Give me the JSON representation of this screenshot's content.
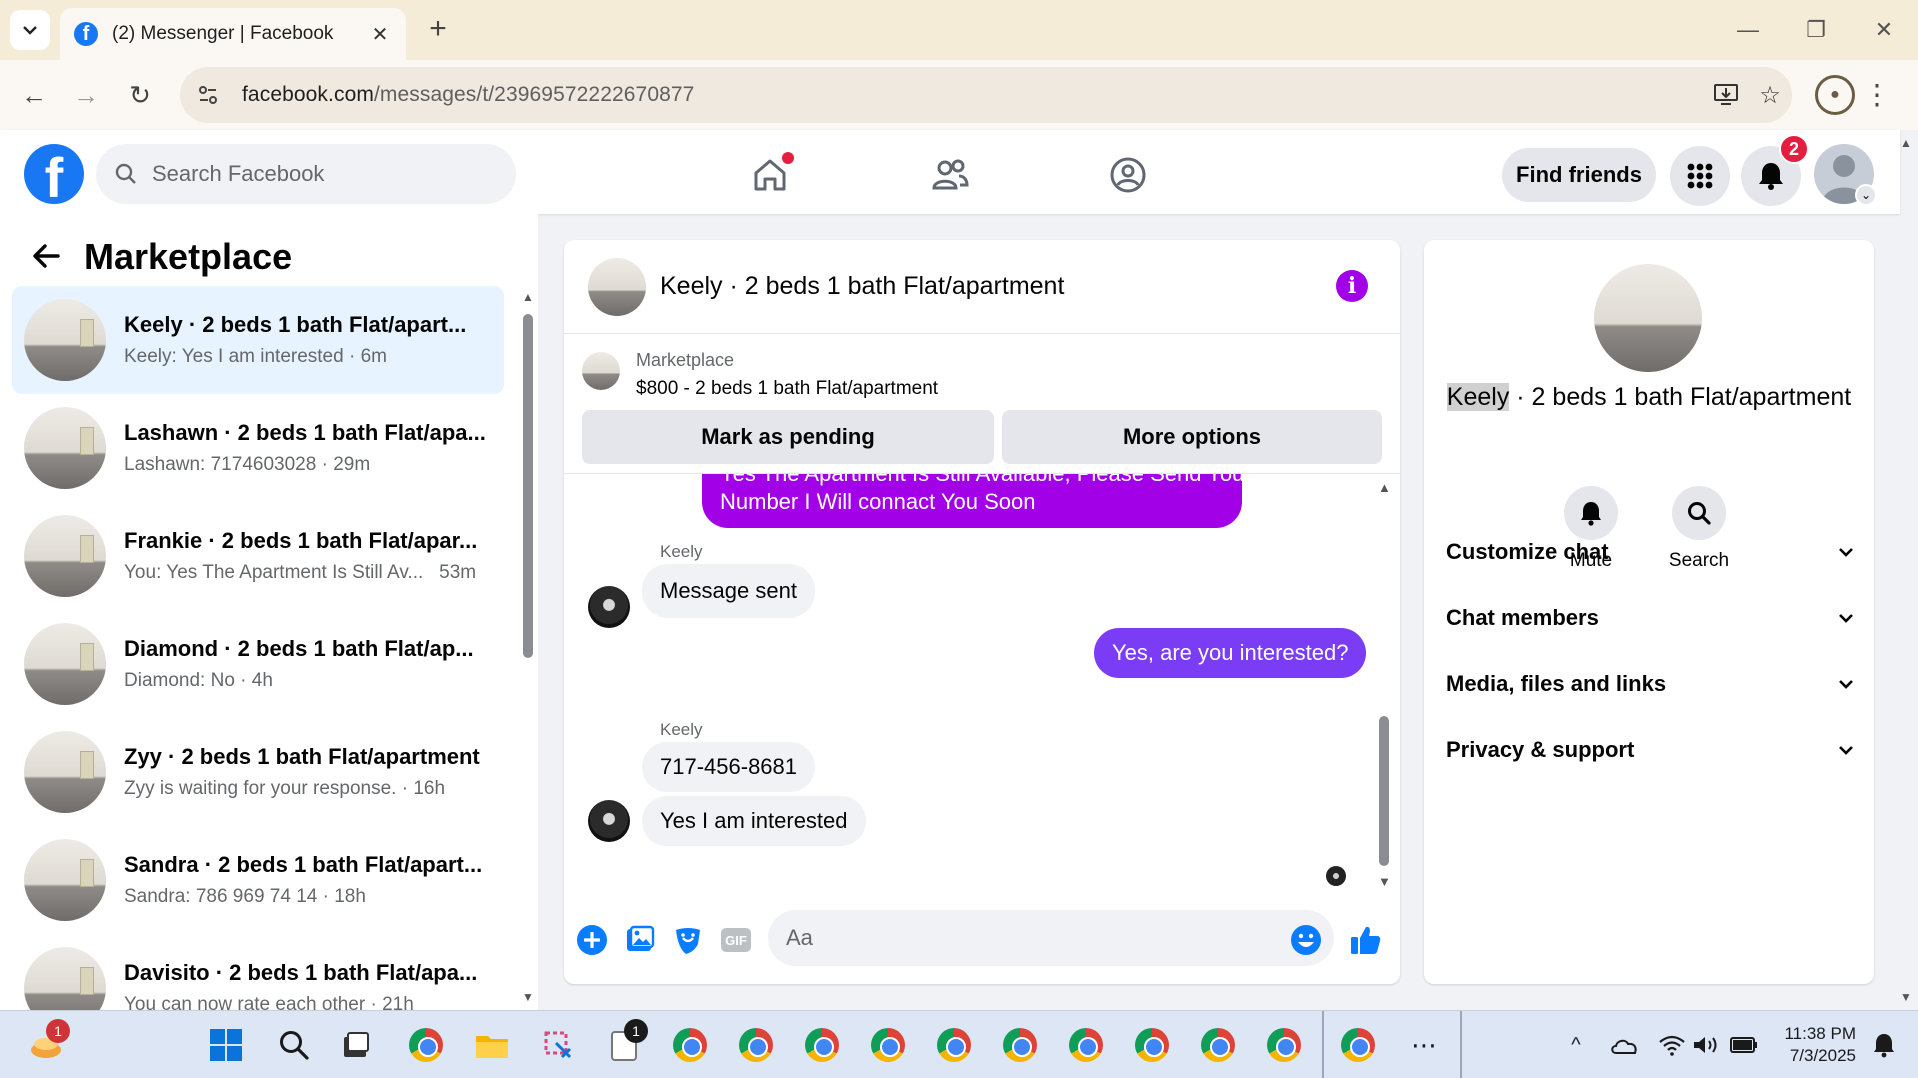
{
  "browser": {
    "tab_title": "(2) Messenger | Facebook",
    "url_host": "facebook.com",
    "url_path": "/messages/t/23969572222670877"
  },
  "header": {
    "search_placeholder": "Search Facebook",
    "find_friends": "Find friends",
    "notifications_count": "2"
  },
  "sidebar": {
    "title": "Marketplace",
    "conversations": [
      {
        "name": "Keely · 2 beds 1 bath Flat/apart...",
        "preview": "Keely: Yes I am interested",
        "time": "6m",
        "active": true
      },
      {
        "name": "Lashawn · 2 beds 1 bath Flat/apa...",
        "preview": "Lashawn: 7174603028",
        "time": "29m"
      },
      {
        "name": "Frankie · 2 beds 1 bath Flat/apar...",
        "preview": "You: Yes The Apartment Is Still Av...",
        "time": "53m"
      },
      {
        "name": "Diamond · 2 beds 1 bath Flat/ap...",
        "preview": "Diamond: No",
        "time": "4h"
      },
      {
        "name": "Zyy · 2 beds 1 bath Flat/apartment",
        "preview": "Zyy is waiting for your response.",
        "time": "16h"
      },
      {
        "name": "Sandra · 2 beds 1 bath Flat/apart...",
        "preview": "Sandra: 786 969 74 14",
        "time": "18h"
      },
      {
        "name": "Davisito · 2 beds 1 bath Flat/apa...",
        "preview": "You can now rate each other",
        "time": "21h"
      }
    ]
  },
  "chat": {
    "title": "Keely · 2 beds 1 bath Flat/apartment",
    "listing_label": "Marketplace",
    "listing_price": "$800 - 2 beds 1 bath Flat/apartment",
    "mark_pending": "Mark as pending",
    "more_options": "More options",
    "messages": {
      "out_1_line1": "Yes The Apartment Is Still Available, Please Send Your Phone",
      "out_1_line2": "Number I Will connact You Soon",
      "sender_1": "Keely",
      "in_1": "Message sent",
      "out_2": "Yes, are you interested?",
      "sender_2": "Keely",
      "in_2": "717-456-8681",
      "in_3": "Yes I am interested"
    },
    "input_placeholder": "Aa"
  },
  "info": {
    "title_name": "Keely",
    "title_rest": " · 2 beds 1 bath Flat/apartment",
    "mute": "Mute",
    "search": "Search",
    "rows": [
      "Customize chat",
      "Chat members",
      "Media, files and links",
      "Privacy & support"
    ]
  },
  "taskbar": {
    "time": "11:38 PM",
    "date": "7/3/2025",
    "widget_badge": "1",
    "notepad_badge": "1"
  },
  "colors": {
    "facebook_blue": "#1877f2",
    "messenger_purple": "#a200e6",
    "outgoing_violet": "#7b3cf6",
    "active_row": "#e7f3ff",
    "notification_red": "#e41e3f"
  }
}
